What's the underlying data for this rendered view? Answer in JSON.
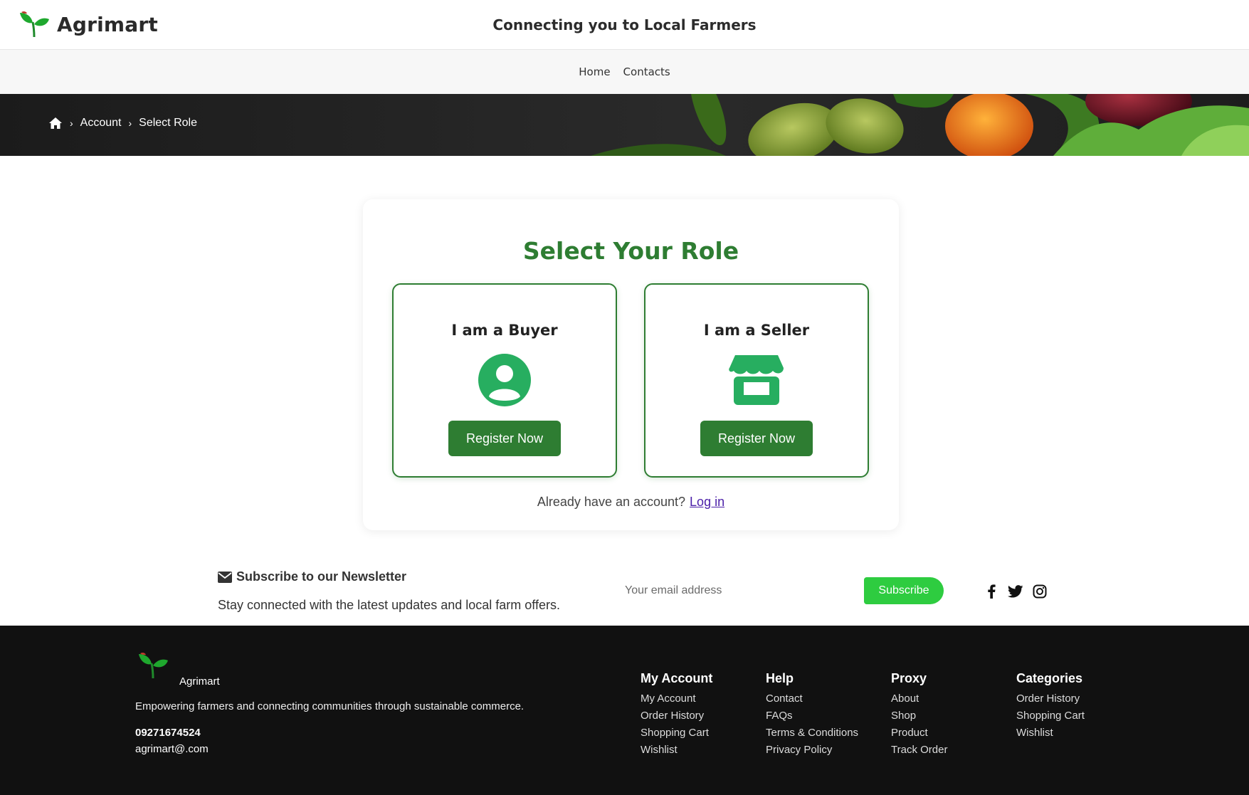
{
  "header": {
    "brand": "Agrimart",
    "tagline": "Connecting you to Local Farmers",
    "nav": [
      "Home",
      "Contacts"
    ]
  },
  "breadcrumb": {
    "items": [
      "Account",
      "Select Role"
    ]
  },
  "role_card": {
    "title": "Select Your Role",
    "buyer": {
      "title": "I am a Buyer",
      "button": "Register Now",
      "icon": "user-circle-icon"
    },
    "seller": {
      "title": "I am a Seller",
      "button": "Register Now",
      "icon": "store-icon"
    },
    "login_prompt": "Already have an account?",
    "login_link": "Log in"
  },
  "newsletter": {
    "title": "Subscribe to our Newsletter",
    "subtitle": "Stay connected with the latest updates and local farm offers.",
    "email_placeholder": "Your email address",
    "subscribe_label": "Subscribe",
    "socials": [
      "facebook-icon",
      "twitter-icon",
      "instagram-icon"
    ]
  },
  "footer": {
    "brand": "Agrimart",
    "description": "Empowering farmers and connecting communities through sustainable commerce.",
    "phone": "09271674524",
    "email": "agrimart@.com",
    "columns": [
      {
        "title": "My Account",
        "links": [
          "My Account",
          "Order History",
          "Shopping Cart",
          "Wishlist"
        ]
      },
      {
        "title": "Help",
        "links": [
          "Contact",
          "FAQs",
          "Terms & Conditions",
          "Privacy Policy"
        ]
      },
      {
        "title": "Proxy",
        "links": [
          "About",
          "Shop",
          "Product",
          "Track Order"
        ]
      },
      {
        "title": "Categories",
        "links": [
          "Order History",
          "Shopping Cart",
          "Wishlist"
        ]
      }
    ]
  },
  "colors": {
    "primary_green": "#2e7d32",
    "icon_green": "#27ae60",
    "subscribe_green": "#2ecc40",
    "footer_bg": "#111111"
  }
}
